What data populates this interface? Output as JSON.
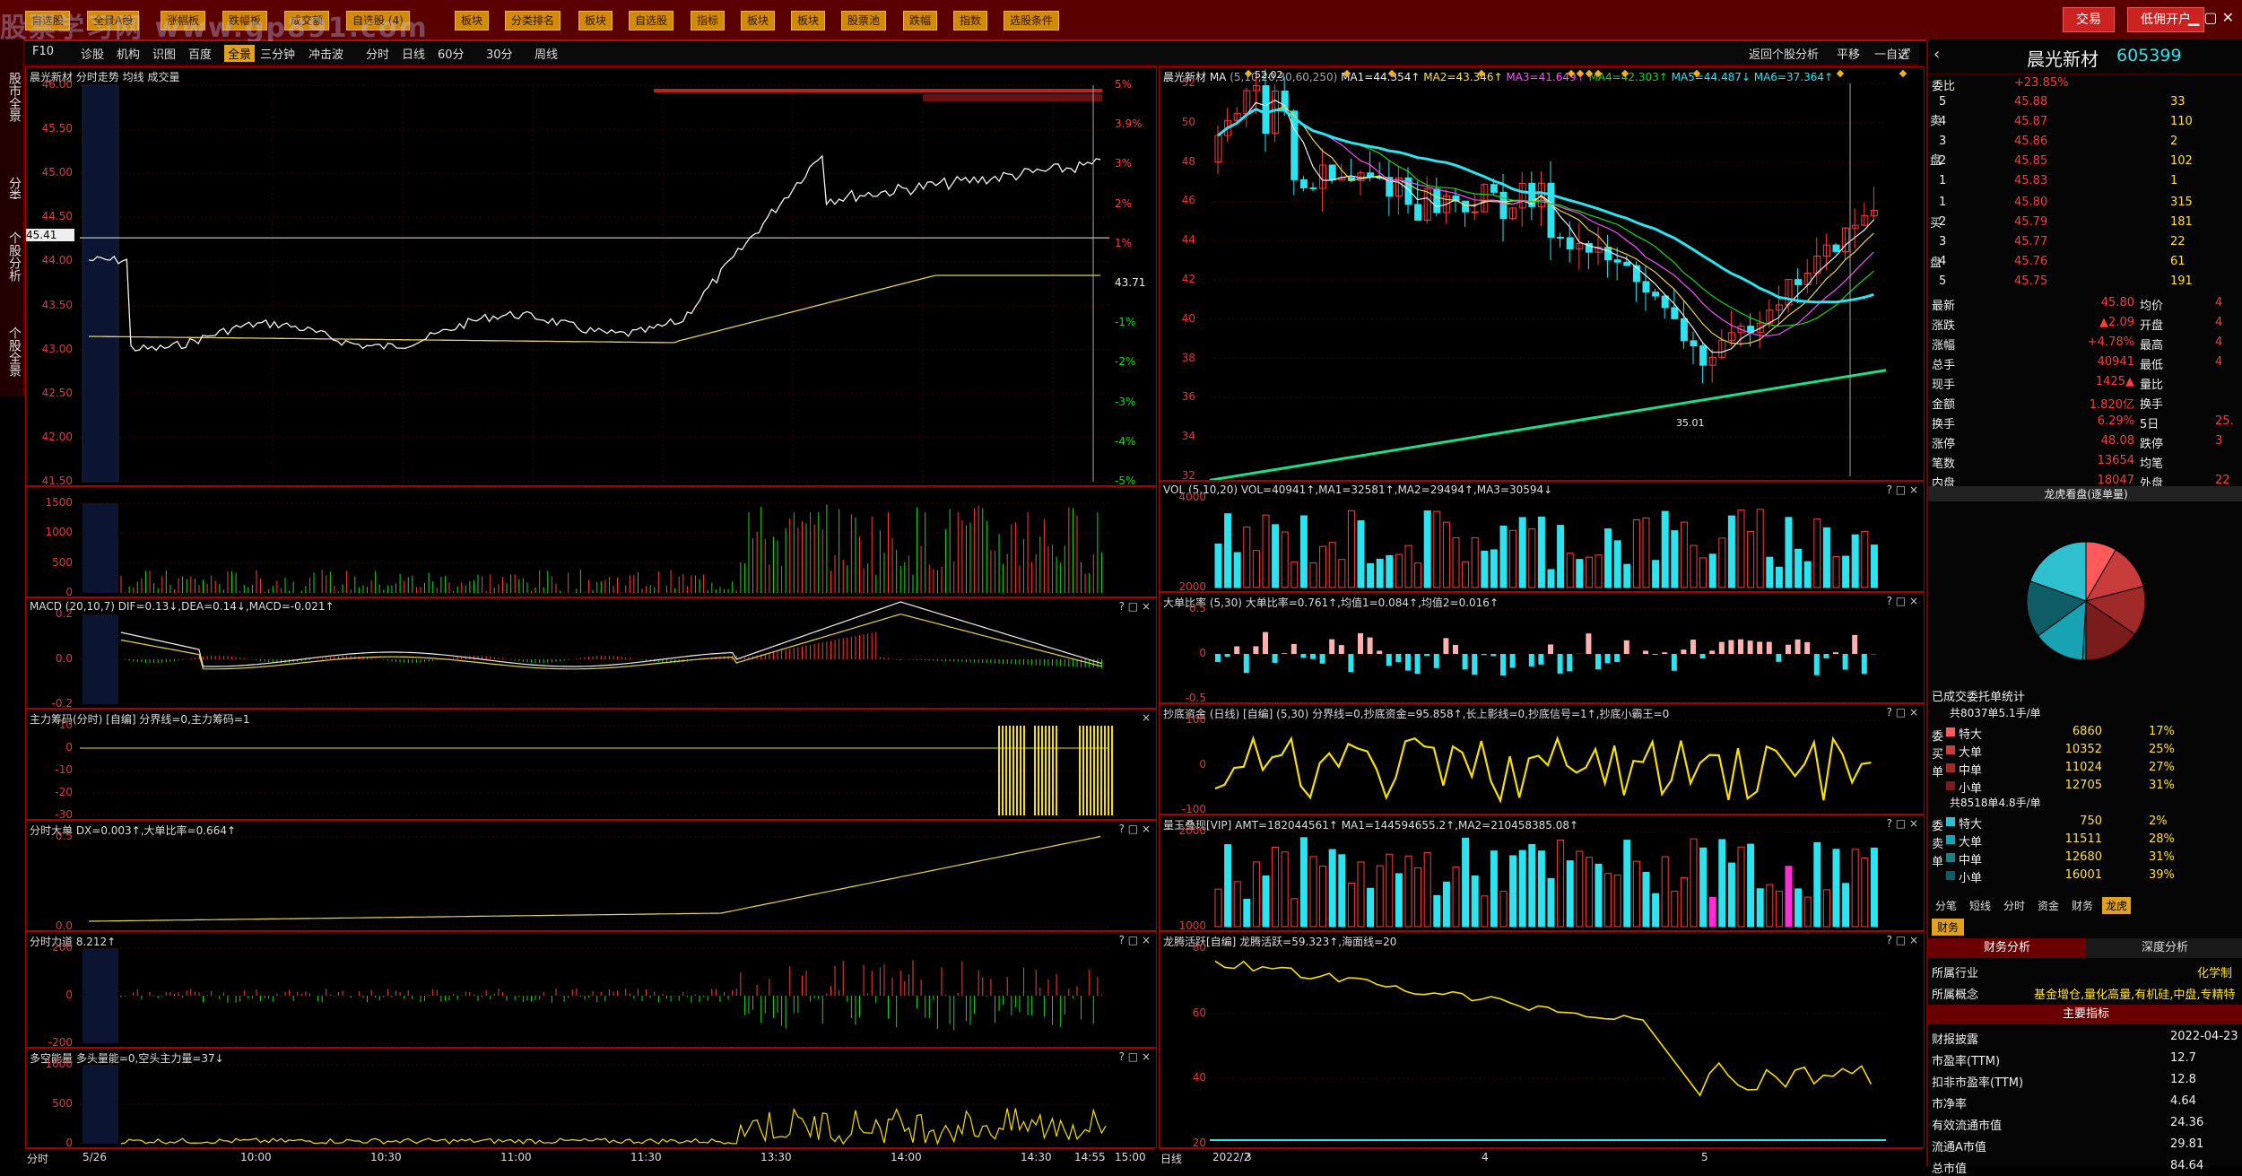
{
  "top_buttons": [
    "自选股",
    "全景A股",
    "涨幅板",
    "跌幅板",
    "成交额",
    "自选股 (4)",
    "板块",
    "分类排名",
    "板块",
    "自选股",
    "指标",
    "板块",
    "板块",
    "股票池",
    "跌幅",
    "指数",
    "选股条件"
  ],
  "top_right": {
    "trade": "交易",
    "open_account": "低佣开户"
  },
  "watermark": "股票学习网 www.gp891.com",
  "left_tabs": [
    "股市全景",
    "分类报价",
    "个股分析",
    "个股全景"
  ],
  "toolbar": {
    "items": [
      "F10",
      "诊股",
      "机构",
      "识图",
      "百度",
      "全景",
      "三分钟",
      "冲击波",
      "分时",
      "日线",
      "60分",
      "30分",
      "周线"
    ],
    "active": "全景",
    "right_items": [
      "返回个股分析",
      "平移",
      "一自选"
    ]
  },
  "intraday": {
    "title": "晨光新材 分时走势 均线 成交量",
    "y_labels": [
      "46.00",
      "45.50",
      "45.00",
      "44.50",
      "44.00",
      "43.50",
      "43.00",
      "42.50",
      "42.00",
      "41.50"
    ],
    "pct_labels": [
      "5%",
      "3.9%",
      "3%",
      "2%",
      "1%",
      "43.71",
      "-1%",
      "-2%",
      "-3%",
      "-4%",
      "-5%"
    ],
    "current_price": "45.41",
    "vol_labels": [
      "1500",
      "1000",
      "500",
      "0"
    ],
    "macd_title": "MACD (20,10,7) DIF=0.13↓,DEA=0.14↓,MACD=-0.021↑",
    "macd_labels": [
      "0.2",
      "0.0",
      "-0.2"
    ],
    "zlcm_title": "主力筹码(分时) [自编] 分界线=0,主力筹码=1",
    "zlcm_labels": [
      "10",
      "0",
      "-10",
      "-20",
      "-30"
    ],
    "dadan_title": "分时大单 DX=0.003↑,大单比率=0.664↑",
    "dadan_labels": [
      "0.5",
      "0.0"
    ],
    "lidao_title": "分时力道 8.212↑",
    "lidao_labels": [
      "200",
      "0",
      "-200"
    ],
    "duokong_title": "多空能量 多头量能=0,空头主力量=37↓",
    "duokong_labels": [
      "1000",
      "500",
      "0"
    ],
    "x_labels": [
      "分时",
      "5/26",
      "10:00",
      "10:30",
      "11:00",
      "11:30",
      "13:30",
      "14:00",
      "14:30",
      "14:55",
      "15:00"
    ]
  },
  "daily": {
    "title_name": "晨光新材 MA",
    "ma_params": "(5,10,20,30,60,250)",
    "ma1": "MA1=44.354↑",
    "ma2": "MA2=43.346↑",
    "ma3": "MA3=41.649↑",
    "ma4": "MA4=42.303↑",
    "ma5": "MA5=44.487↓",
    "ma6": "MA6=37.364↑",
    "y_labels": [
      "52",
      "50",
      "48",
      "46",
      "44",
      "42",
      "40",
      "38",
      "36",
      "34",
      "32"
    ],
    "high_label": "52.02",
    "low_label": "35.01",
    "vol_title": "VOL (5,10,20) VOL=40941↑,MA1=32581↑,MA2=29494↑,MA3=30594↓",
    "vol_labels": [
      "4000",
      "2000"
    ],
    "dadan_title": "大单比率 (5,30) 大单比率=0.761↑,均值1=0.084↑,均值2=0.016↑",
    "dadan_labels": [
      "0.5",
      "0",
      "-0.5"
    ],
    "chaodi_title": "抄底资金 (日线) [自编] (5,30) 分界线=0,抄底资金=95.858↑,长上影线=0,抄底信号=1↑,抄底小霸王=0",
    "chaodi_labels": [
      "100",
      "0",
      "-100"
    ],
    "lw_title": "量王叠现[VIP] AMT=182044561↑ MA1=144594655.2↑,MA2=210458385.08↑",
    "lw_labels": [
      "2000",
      "1000"
    ],
    "lt_title": "龙腾活跃[自编] 龙腾活跃=59.323↑,海面线=20",
    "lt_labels": [
      "80",
      "60",
      "40",
      "20"
    ],
    "x_labels": [
      "日线",
      "2022/2",
      "3",
      "4",
      "5"
    ],
    "right_buttons": "? □ ×"
  },
  "side": {
    "name": "晨光新材",
    "code": "605399",
    "weibi_label": "委比",
    "weibi_value": "+23.85%",
    "sell": [
      {
        "lvl": "5",
        "price": "45.88",
        "vol": "33"
      },
      {
        "lvl": "4",
        "price": "45.87",
        "vol": "110"
      },
      {
        "lvl": "3",
        "price": "45.86",
        "vol": "2"
      },
      {
        "lvl": "2",
        "price": "45.85",
        "vol": "102"
      },
      {
        "lvl": "1",
        "price": "45.83",
        "vol": "1"
      }
    ],
    "buy": [
      {
        "lvl": "1",
        "price": "45.80",
        "vol": "315"
      },
      {
        "lvl": "2",
        "price": "45.79",
        "vol": "181"
      },
      {
        "lvl": "3",
        "price": "45.77",
        "vol": "22"
      },
      {
        "lvl": "4",
        "price": "45.76",
        "vol": "61"
      },
      {
        "lvl": "5",
        "price": "45.75",
        "vol": "191"
      }
    ],
    "sell_side_chars": [
      "卖",
      "盘"
    ],
    "buy_side_chars": [
      "买",
      "盘"
    ],
    "quotes": [
      {
        "l": "最新",
        "v": "45.80",
        "l2": "均价",
        "v2": "4"
      },
      {
        "l": "涨跌",
        "v": "▲2.09",
        "l2": "开盘",
        "v2": "4"
      },
      {
        "l": "涨幅",
        "v": "+4.78%",
        "l2": "最高",
        "v2": "4"
      },
      {
        "l": "总手",
        "v": "40941",
        "l2": "最低",
        "v2": "4"
      },
      {
        "l": "现手",
        "v": "1425▲",
        "l2": "量比",
        "v2": ""
      },
      {
        "l": "金额",
        "v": "1.820亿",
        "l2": "换手",
        "v2": ""
      },
      {
        "l": "换手",
        "v": "6.29%",
        "l2": "5日",
        "v2": "25."
      },
      {
        "l": "涨停",
        "v": "48.08",
        "l2": "跌停",
        "v2": "3"
      },
      {
        "l": "笔数",
        "v": "13654",
        "l2": "均笔",
        "v2": ""
      },
      {
        "l": "内盘",
        "v": "18047",
        "l2": "外盘",
        "v2": "22"
      }
    ],
    "pie_title": "龙虎看盘(逐单量)",
    "pie_colors": [
      "#ff5a5a",
      "#c83c3c",
      "#a02a2a",
      "#7a1c1c",
      "#1f7d86",
      "#17a3b3",
      "#0e5c66",
      "#2fc0d0"
    ],
    "pie_values": [
      6860,
      10352,
      11024,
      12705,
      750,
      11511,
      12680,
      16001
    ],
    "stat_title": "已成交委托单统计",
    "buy_total": "共8037单5.1手/单",
    "buy_rows": [
      {
        "t": "特大",
        "n": "6860",
        "p": "17%",
        "c": "#ff5a5a"
      },
      {
        "t": "大单",
        "n": "10352",
        "p": "25%",
        "c": "#c83c3c"
      },
      {
        "t": "中单",
        "n": "11024",
        "p": "27%",
        "c": "#a02a2a"
      },
      {
        "t": "小单",
        "n": "12705",
        "p": "31%",
        "c": "#7a1c1c"
      }
    ],
    "buy_side_label": [
      "委",
      "买",
      "单"
    ],
    "sell_total": "共8518单4.8手/单",
    "sell_rows": [
      {
        "t": "特大",
        "n": "750",
        "p": "2%",
        "c": "#2fc0d0"
      },
      {
        "t": "大单",
        "n": "11511",
        "p": "28%",
        "c": "#17a3b3"
      },
      {
        "t": "中单",
        "n": "12680",
        "p": "31%",
        "c": "#1f7d86"
      },
      {
        "t": "小单",
        "n": "16001",
        "p": "39%",
        "c": "#0e5c66"
      }
    ],
    "sell_side_label": [
      "委",
      "卖",
      "单"
    ],
    "bottom_tabs": [
      "分笔",
      "短线",
      "分时",
      "资金",
      "财务",
      "龙虎"
    ],
    "active_tab": "龙虎",
    "fin_tab": "财务",
    "fin_analysis": "财务分析",
    "depth_analysis": "深度分析",
    "industry_label": "所属行业",
    "industry_value": "化学制",
    "concept_label": "所属概念",
    "concept_value": "基金增仓,量化高量,有机硅,中盘,专精特",
    "main_index": "主要指标",
    "fin_rows": [
      {
        "l": "财报披露",
        "v": "2022-04-23"
      },
      {
        "l": "市盈率(TTM)",
        "v": "12.7"
      },
      {
        "l": "扣非市盈率(TTM)",
        "v": "12.8"
      },
      {
        "l": "市净率",
        "v": "4.64"
      },
      {
        "l": "有效流通市值",
        "v": "24.36"
      },
      {
        "l": "流通A市值",
        "v": "29.81"
      },
      {
        "l": "总市值",
        "v": "84.64"
      }
    ]
  }
}
